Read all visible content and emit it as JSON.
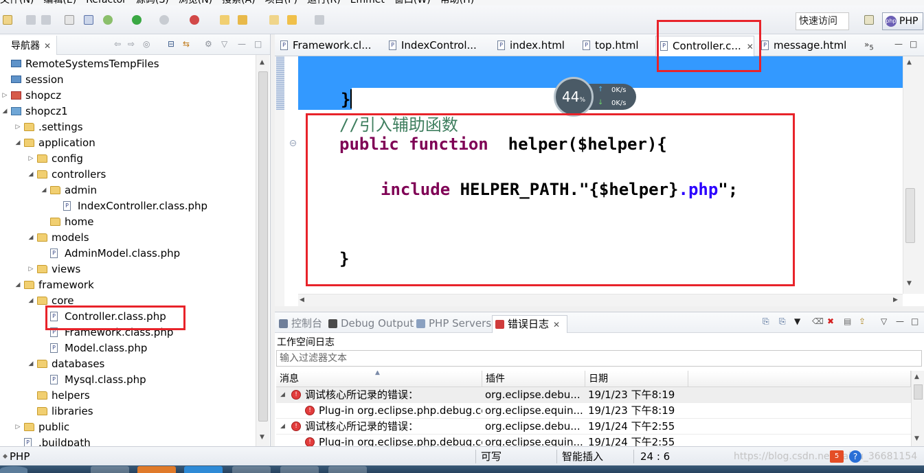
{
  "menubar": {
    "items": [
      "文件(N)",
      "编辑(E)",
      "Refactor",
      "源码(S)",
      "浏览(N)",
      "搜索(A)",
      "项目(P)",
      "运行(R)",
      "Emmet",
      "窗口(W)",
      "帮助(H)"
    ]
  },
  "toolbar": {
    "quick_access": "快速访问",
    "perspective": "PHP"
  },
  "navigator": {
    "title": "导航器",
    "tree": [
      {
        "label": "RemoteSystemsTempFiles",
        "depth": 0,
        "icon": "server",
        "arrow": ""
      },
      {
        "label": "session",
        "depth": 0,
        "icon": "server",
        "arrow": ""
      },
      {
        "label": "shopcz",
        "depth": 0,
        "icon": "project-red",
        "arrow": "▷"
      },
      {
        "label": "shopcz1",
        "depth": 0,
        "icon": "project",
        "arrow": "◢"
      },
      {
        "label": ".settings",
        "depth": 1,
        "icon": "folder",
        "arrow": "▷"
      },
      {
        "label": "application",
        "depth": 1,
        "icon": "folder",
        "arrow": "◢"
      },
      {
        "label": "config",
        "depth": 2,
        "icon": "folder",
        "arrow": "▷"
      },
      {
        "label": "controllers",
        "depth": 2,
        "icon": "folder",
        "arrow": "◢"
      },
      {
        "label": "admin",
        "depth": 3,
        "icon": "folder",
        "arrow": "◢"
      },
      {
        "label": "IndexController.class.php",
        "depth": 4,
        "icon": "file",
        "arrow": ""
      },
      {
        "label": "home",
        "depth": 3,
        "icon": "folder",
        "arrow": ""
      },
      {
        "label": "models",
        "depth": 2,
        "icon": "folder",
        "arrow": "◢"
      },
      {
        "label": "AdminModel.class.php",
        "depth": 3,
        "icon": "file",
        "arrow": ""
      },
      {
        "label": "views",
        "depth": 2,
        "icon": "folder",
        "arrow": "▷"
      },
      {
        "label": "framework",
        "depth": 1,
        "icon": "folder",
        "arrow": "◢"
      },
      {
        "label": "core",
        "depth": 2,
        "icon": "folder",
        "arrow": "◢"
      },
      {
        "label": "Controller.class.php",
        "depth": 3,
        "icon": "file",
        "arrow": ""
      },
      {
        "label": "Framework.class.php",
        "depth": 3,
        "icon": "file",
        "arrow": ""
      },
      {
        "label": "Model.class.php",
        "depth": 3,
        "icon": "file",
        "arrow": ""
      },
      {
        "label": "databases",
        "depth": 2,
        "icon": "folder",
        "arrow": "◢"
      },
      {
        "label": "Mysql.class.php",
        "depth": 3,
        "icon": "file",
        "arrow": ""
      },
      {
        "label": "helpers",
        "depth": 2,
        "icon": "folder",
        "arrow": ""
      },
      {
        "label": "libraries",
        "depth": 2,
        "icon": "folder",
        "arrow": ""
      },
      {
        "label": "public",
        "depth": 1,
        "icon": "folder",
        "arrow": "▷"
      },
      {
        "label": ".buildpath",
        "depth": 1,
        "icon": "file",
        "arrow": ""
      }
    ]
  },
  "editor": {
    "tabs": [
      {
        "label": "Framework.cl...",
        "active": false
      },
      {
        "label": "IndexControl...",
        "active": false
      },
      {
        "label": "index.html",
        "active": false
      },
      {
        "label": "top.html",
        "active": false
      },
      {
        "label": "Controller.c...",
        "active": true
      },
      {
        "label": "message.html",
        "active": false
      }
    ],
    "overflow_count": "5",
    "code": {
      "line1_brace": "}",
      "comment": "//引入辅助函数",
      "kw_public": "public",
      "kw_function": "function",
      "fn_sig": "helper($helper){",
      "kw_include": "include",
      "include_const": "HELPER_PATH.",
      "str_open": "\"",
      "str_var": "{$helper}",
      "str_php": ".php",
      "str_close": "\"",
      "semicolon": ";",
      "closing_brace": "}"
    }
  },
  "speed_widget": {
    "percent": "44",
    "percent_sign": "%",
    "up": "0K/s",
    "down": "0K/s"
  },
  "bottom_panel": {
    "tabs": [
      {
        "label": "控制台",
        "active": false
      },
      {
        "label": "Debug Output",
        "active": false
      },
      {
        "label": "PHP Servers",
        "active": false
      },
      {
        "label": "错误日志",
        "active": true
      }
    ],
    "log_title": "工作空间日志",
    "filter_placeholder": "输入过滤器文本",
    "columns": [
      "消息",
      "插件",
      "日期"
    ],
    "rows": [
      {
        "message": "调试核心所记录的错误：",
        "plugin": "org.eclipse.debu...",
        "date": "19/1/23 下午8:19",
        "indent": 0,
        "arrow": "◢"
      },
      {
        "message": "Plug-in org.eclipse.php.debug.co",
        "plugin": "org.eclipse.equin...",
        "date": "19/1/23 下午8:19",
        "indent": 1,
        "arrow": ""
      },
      {
        "message": "调试核心所记录的错误：",
        "plugin": "org.eclipse.debu...",
        "date": "19/1/24 下午2:55",
        "indent": 0,
        "arrow": "◢"
      },
      {
        "message": "Plug-in org.eclipse.php.debug.co",
        "plugin": "org.eclipse.equin...",
        "date": "19/1/24 下午2:55",
        "indent": 1,
        "arrow": ""
      }
    ]
  },
  "statusbar": {
    "left": "PHP",
    "writable": "可写",
    "insert_mode": "智能插入",
    "position": "24 : 6",
    "watermark": "https://blog.csdn.net/baidu_36681154"
  }
}
